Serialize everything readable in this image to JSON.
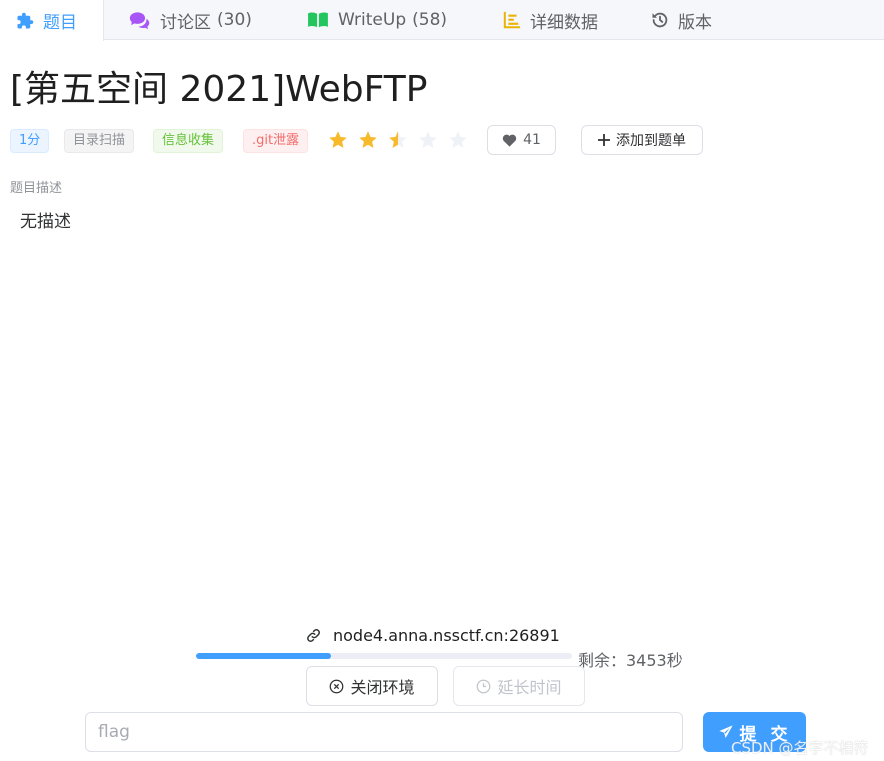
{
  "tabs": [
    {
      "label": "题目",
      "count": "",
      "icon": "puzzle-icon",
      "active": true
    },
    {
      "label": "讨论区",
      "count": "(30)",
      "icon": "chat-icon",
      "active": false
    },
    {
      "label": "WriteUp",
      "count": "(58)",
      "icon": "book-icon",
      "active": false
    },
    {
      "label": "详细数据",
      "count": "",
      "icon": "bar-chart-icon",
      "active": false
    },
    {
      "label": "版本",
      "count": "",
      "icon": "history-icon",
      "active": false
    }
  ],
  "challenge": {
    "title": "[第五空间 2021]WebFTP",
    "tags": [
      "1分",
      "目录扫描",
      "信息收集",
      ".git泄露"
    ],
    "rating": {
      "value": 2.5,
      "max": 5
    },
    "likes": "41",
    "add_to_list": "添加到题单",
    "description_label": "题目描述",
    "description": "无描述"
  },
  "environment": {
    "address": "node4.anna.nssctf.cn:26891",
    "progress_fraction": 0.36,
    "remaining": "剩余：3453秒",
    "close_label": "关闭环境",
    "extend_label": "延长时间"
  },
  "submit": {
    "placeholder": "flag",
    "value": "",
    "button_label": "提 交"
  },
  "watermark": "CSDN @名字不相符",
  "colors": {
    "primary": "#409eff",
    "star": "#f7ba2a",
    "star_empty": "#eff2f7",
    "tab_puzzle": "#409eff",
    "tab_chat": "#a855f7",
    "tab_book": "#22c55e",
    "tab_chart": "#eab308",
    "tab_history": "#606266"
  }
}
